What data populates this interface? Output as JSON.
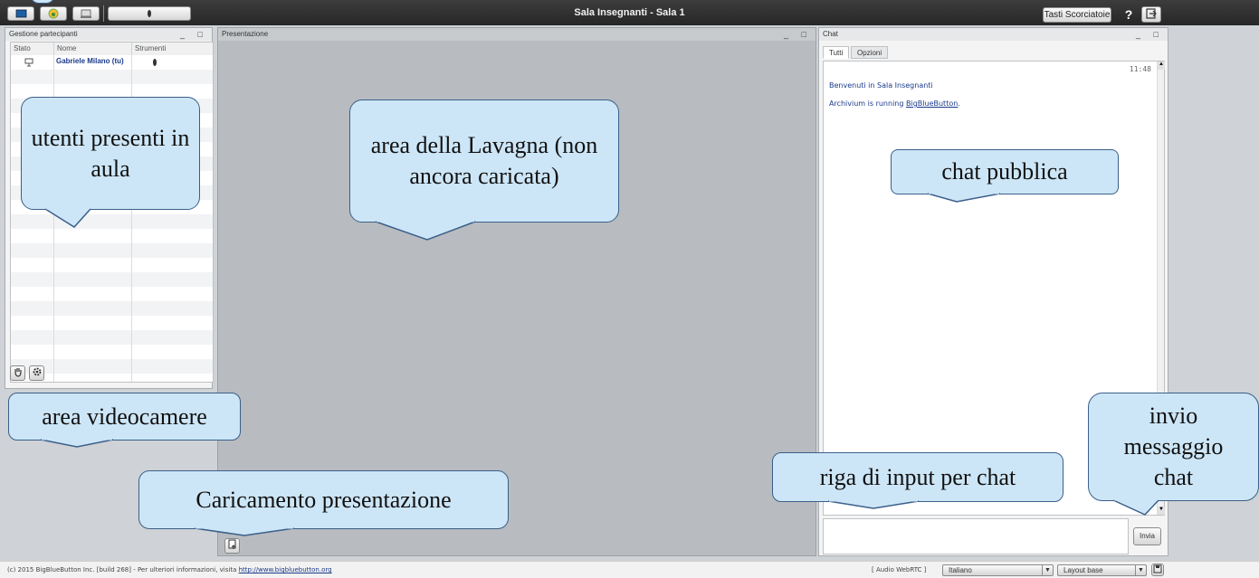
{
  "app": {
    "title": "Sala Insegnanti - Sala 1",
    "shortcut_label": "Tasti Scorciatoie",
    "help_label": "?"
  },
  "participants": {
    "header": "Gestione partecipanti",
    "window_controls": "_ □",
    "columns": [
      "Stato",
      "Nome",
      "Strumenti"
    ],
    "rows": [
      {
        "name": "Gabriele Milano (tu)"
      }
    ]
  },
  "presentation": {
    "header": "Presentazione",
    "window_controls": "_ □"
  },
  "chat": {
    "header": "Chat",
    "window_controls": "_ □",
    "tabs": [
      "Tutti",
      "Opzioni"
    ],
    "timestamp": "11:48",
    "messages": {
      "welcome": "Benvenuti in Sala Insegnanti",
      "running_prefix": "Archivium is running ",
      "running_link": "BigBlueButton",
      "running_suffix": "."
    },
    "send_label": "Invia"
  },
  "footer": {
    "copyright": "(c) 2015 BigBlueButton Inc. [build 268] - Per ulteriori informazioni, visita ",
    "link": "http://www.bigbluebutton.org",
    "audio": "[ Audio WebRTC ]",
    "language": "Italiano",
    "layout": "Layout base"
  },
  "annotations": {
    "users": "utenti presenti in aula",
    "board": "area della Lavagna (non ancora caricata)",
    "chat": "chat pubblica",
    "video": "area videocamere",
    "upload": "Caricamento presentazione",
    "input": "riga di input per chat",
    "send": "invio messaggio chat"
  },
  "colors": {
    "topbar": "#2f2f2f",
    "callout_fill": "#cde6f7",
    "callout_border": "#3b5f8a",
    "link": "#1a3a8a"
  }
}
